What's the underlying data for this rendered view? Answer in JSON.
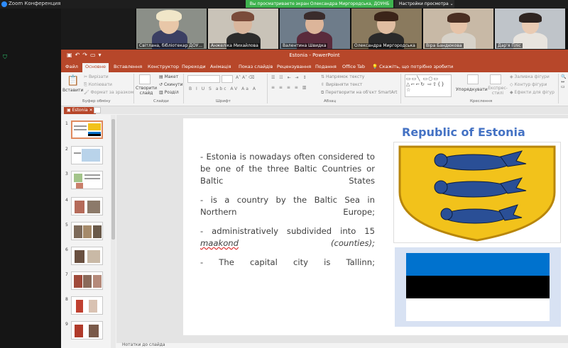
{
  "zoom": {
    "app_title": "Zoom Конференция",
    "share_banner": "Вы просматриваете экран Олександра Миргородська, ДОУНБ",
    "view_options": "Настройки просмотра"
  },
  "participants": [
    {
      "name": "Світлана, бібліотекар ДОУ..."
    },
    {
      "name": "Анжеліка Михайлова"
    },
    {
      "name": "Валентина Швидка"
    },
    {
      "name": "Олександра Миргородська"
    },
    {
      "name": "Віра Бандюкова"
    },
    {
      "name": "Дар'я Пліс"
    }
  ],
  "powerpoint": {
    "window_title": "Estonia - PowerPoint",
    "tabs": [
      "Файл",
      "Основне",
      "Вставлення",
      "Конструктор",
      "Переходи",
      "Анімація",
      "Показ слайдів",
      "Рецензування",
      "Подання",
      "Office Tab"
    ],
    "active_tab": "Основне",
    "tell_me": "Скажіть, що потрібно зробити",
    "ribbon": {
      "paste": "Вставити",
      "cut": "Вирізати",
      "copy": "Копіювати",
      "format_painter": "Формат за зразком",
      "clipboard_group": "Буфер обміну",
      "new_slide": "Створити слайд",
      "layout": "Макет",
      "reset": "Скинути",
      "sections": "Розділ",
      "slides_group": "Слайди",
      "font_group": "Шрифт",
      "text_direction": "Напрямок тексту",
      "align_text": "Вирівняти текст",
      "smartart": "Перетворити на об'єкт SmartArt",
      "paragraph_group": "Абзац",
      "arrange": "Упорядкувати",
      "quick_styles": "Експрес-стилі",
      "shape_fill": "Заливка фігури",
      "shape_outline": "Контур фігури",
      "shape_effects": "Ефекти для фігур",
      "drawing_group": "Креслення"
    },
    "doc_tab": "Estonia",
    "slide_numbers": [
      "1",
      "2",
      "3",
      "4",
      "5",
      "6",
      "7",
      "8",
      "9"
    ],
    "notes_placeholder": "Нотатки до слайда"
  },
  "slide": {
    "title": "Republic of Estonia",
    "paragraphs": [
      "- Estonia is nowadays often considered to be one of the three Baltic Countries or Baltic States",
      "- is a country by the Baltic Sea in Northern Europe;",
      "- The capital city is Tallinn;"
    ],
    "para3_start": "- administratively subdivided into 15",
    "para3_word": "maakond",
    "para3_end": "(counties);"
  },
  "colors": {
    "ppt_red": "#b7472a",
    "zoom_green": "#3fb34f",
    "title_blue": "#4472c4",
    "flag_blue": "#0072ce",
    "coat_gold": "#f2c21b"
  }
}
